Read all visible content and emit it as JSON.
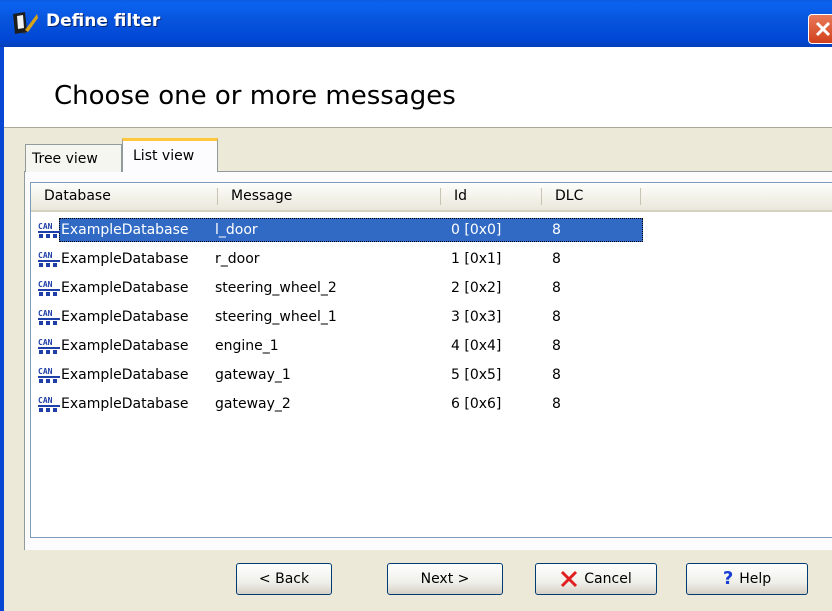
{
  "window": {
    "title": "Define filter"
  },
  "header": {
    "title": "Choose one or more messages"
  },
  "tabs": [
    {
      "label": "Tree view",
      "active": false
    },
    {
      "label": "List view",
      "active": true
    }
  ],
  "list": {
    "columns": [
      "Database",
      "Message",
      "Id",
      "DLC"
    ],
    "icon": "can-database-icon",
    "rows": [
      {
        "database": "ExampleDatabase",
        "message": "l_door",
        "id": "0 [0x0]",
        "dlc": "8",
        "selected": true
      },
      {
        "database": "ExampleDatabase",
        "message": "r_door",
        "id": "1 [0x1]",
        "dlc": "8",
        "selected": false
      },
      {
        "database": "ExampleDatabase",
        "message": "steering_wheel_2",
        "id": "2 [0x2]",
        "dlc": "8",
        "selected": false
      },
      {
        "database": "ExampleDatabase",
        "message": "steering_wheel_1",
        "id": "3 [0x3]",
        "dlc": "8",
        "selected": false
      },
      {
        "database": "ExampleDatabase",
        "message": "engine_1",
        "id": "4 [0x4]",
        "dlc": "8",
        "selected": false
      },
      {
        "database": "ExampleDatabase",
        "message": "gateway_1",
        "id": "5 [0x5]",
        "dlc": "8",
        "selected": false
      },
      {
        "database": "ExampleDatabase",
        "message": "gateway_2",
        "id": "6 [0x6]",
        "dlc": "8",
        "selected": false
      }
    ]
  },
  "buttons": {
    "back": "< Back",
    "next": "Next >",
    "cancel": "Cancel",
    "help": "Help"
  },
  "colors": {
    "selection": "#316ac5",
    "titlebar": "#0054e3",
    "cancel_icon": "#e02020",
    "help_icon": "#1a3fd6"
  }
}
